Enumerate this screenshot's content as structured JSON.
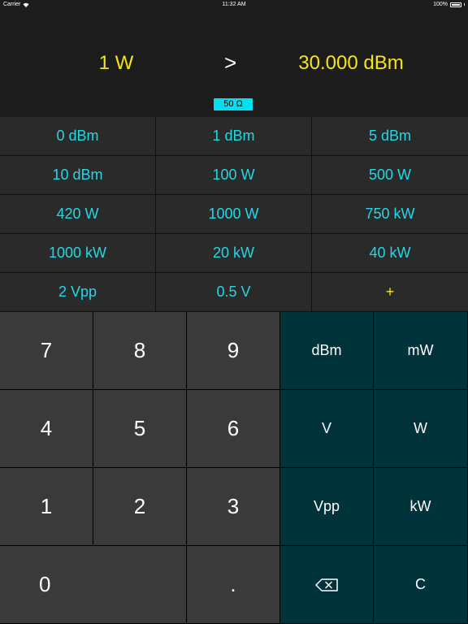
{
  "status_bar": {
    "carrier": "Carrier",
    "time": "11:32 AM",
    "battery": "100%"
  },
  "display": {
    "input": "1 W",
    "arrow": ">",
    "output": "30.000 dBm",
    "impedance": "50 Ω"
  },
  "presets": [
    "0 dBm",
    "1 dBm",
    "5 dBm",
    "10 dBm",
    "100 W",
    "500 W",
    "420 W",
    "1000 W",
    "750 kW",
    "1000 kW",
    "20 kW",
    "40 kW",
    "2 Vpp",
    "0.5 V",
    "+"
  ],
  "keypad": {
    "k7": "7",
    "k8": "8",
    "k9": "9",
    "dbm": "dBm",
    "mw": "mW",
    "k4": "4",
    "k5": "5",
    "k6": "6",
    "v": "V",
    "w": "W",
    "k1": "1",
    "k2": "2",
    "k3": "3",
    "vpp": "Vpp",
    "kw": "kW",
    "k0": "0",
    "dot": ".",
    "clear": "C"
  },
  "colors": {
    "yellow": "#f5e60f",
    "cyan": "#22d8e6",
    "badge": "#00e0ee",
    "unit_key": "#01333a",
    "digit_key": "#3a3a3a"
  }
}
